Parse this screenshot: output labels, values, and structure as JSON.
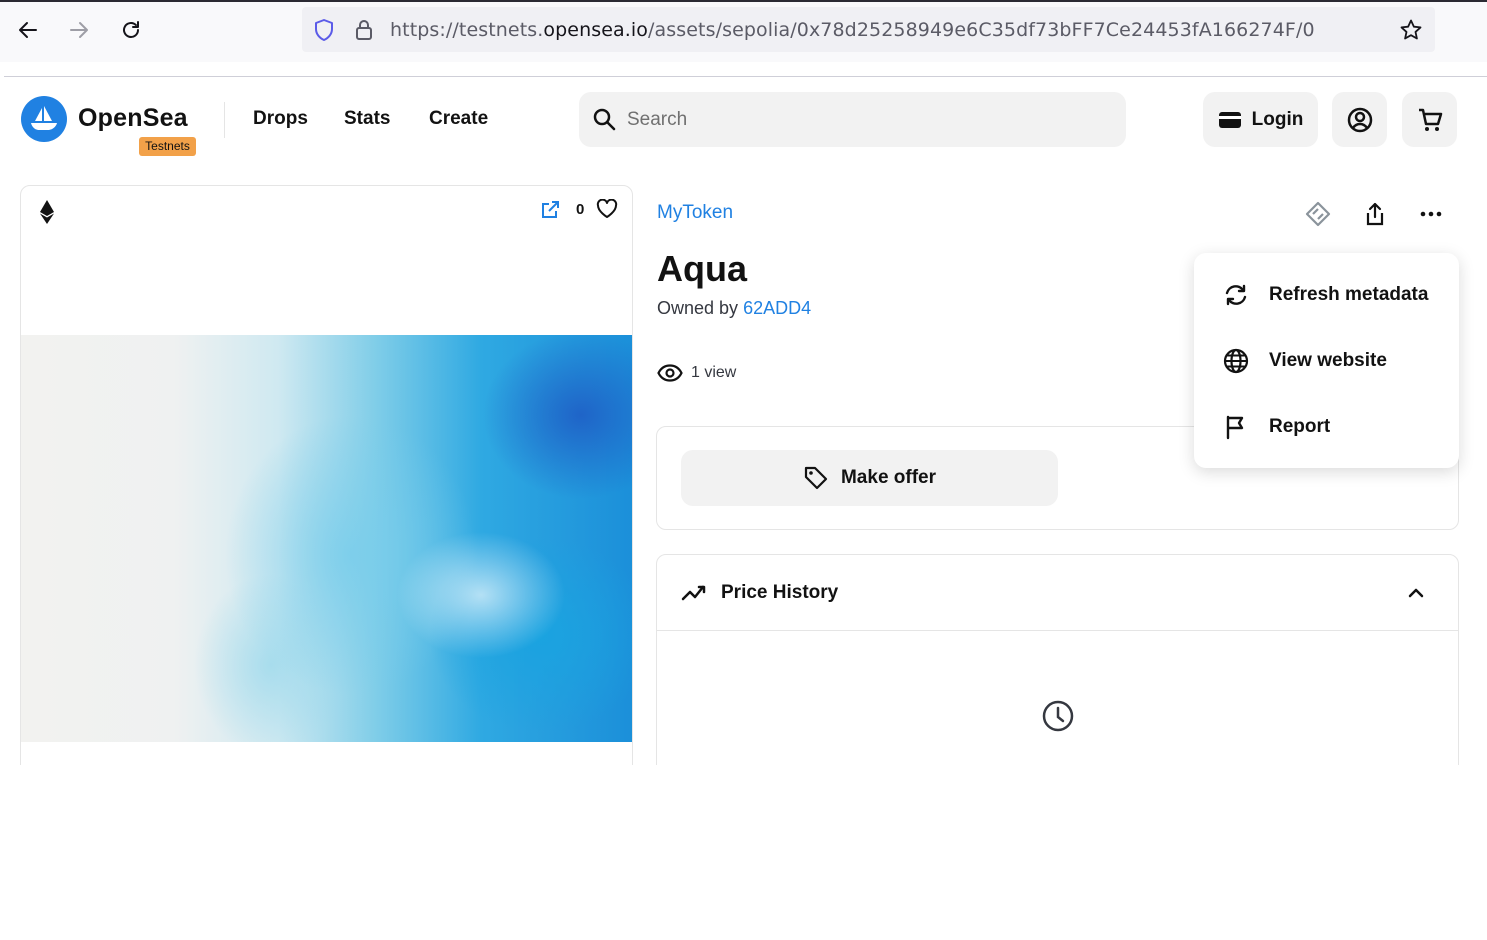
{
  "browser": {
    "url_scheme": "https://testnets.",
    "url_host": "opensea.io",
    "url_path": "/assets/sepolia/0x78d25258949e6C35df73bFF7Ce24453fA166274F/0"
  },
  "header": {
    "brand": "OpenSea",
    "badge": "Testnets",
    "nav": [
      "Drops",
      "Stats",
      "Create"
    ],
    "search_placeholder": "Search",
    "login_label": "Login"
  },
  "media": {
    "favorite_count": "0"
  },
  "asset": {
    "collection": "MyToken",
    "title": "Aqua",
    "owned_by_prefix": "Owned by",
    "owner": "62ADD4",
    "views": "1 view"
  },
  "offer": {
    "make_offer_label": "Make offer"
  },
  "price_history": {
    "title": "Price History"
  },
  "menu": {
    "items": [
      {
        "label": "Refresh metadata",
        "icon": "refresh-icon"
      },
      {
        "label": "View website",
        "icon": "globe-icon"
      },
      {
        "label": "Report",
        "icon": "flag-icon"
      }
    ]
  },
  "colors": {
    "accent": "#2081e2",
    "badge": "#f2a149"
  }
}
